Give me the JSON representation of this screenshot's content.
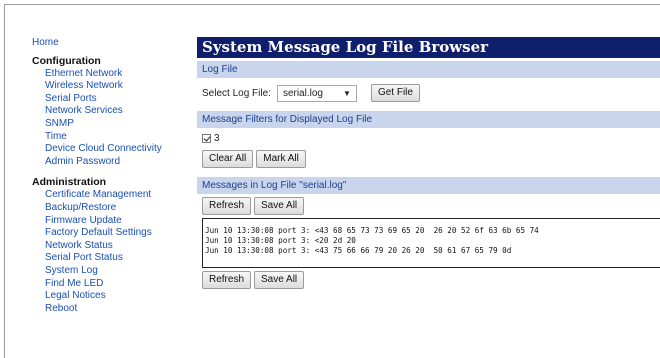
{
  "sidebar": {
    "home": "Home",
    "configuration": {
      "heading": "Configuration",
      "items": [
        "Ethernet Network",
        "Wireless Network",
        "Serial Ports",
        "Network Services",
        "SNMP",
        "Time",
        "Device Cloud Connectivity",
        "Admin Password"
      ]
    },
    "administration": {
      "heading": "Administration",
      "items": [
        "Certificate Management",
        "Backup/Restore",
        "Firmware Update",
        "Factory Default Settings",
        "Network Status",
        "Serial Port Status",
        "System Log",
        "Find Me LED",
        "Legal Notices",
        "Reboot"
      ]
    }
  },
  "main": {
    "title": "System Message Log File Browser",
    "log_file": {
      "heading": "Log File",
      "select_label": "Select Log File:",
      "selected": "serial.log",
      "get_button": "Get File"
    },
    "filters": {
      "heading": "Message Filters for Displayed Log File",
      "checkbox_label": "3",
      "clear_button": "Clear All",
      "mark_button": "Mark All"
    },
    "messages": {
      "heading": "Messages in Log File \"serial.log\"",
      "refresh_button": "Refresh",
      "save_button": "Save All",
      "lines": [
        "Jun 10 13:30:08 port 3: <43 68 65 73 73 69 65 20  26 20 52 6f 63 6b 65 74",
        "Jun 10 13:30:08 port 3: <20 2d 20",
        "Jun 10 13:30:08 port 3: <43 75 66 66 79 20 26 20  50 61 67 65 79 0d"
      ]
    }
  },
  "colors": {
    "title_bg": "#0f1f6b",
    "section_bg": "#c8d5ec",
    "section_text": "#1f3f8f",
    "link": "#1a4fb3"
  }
}
